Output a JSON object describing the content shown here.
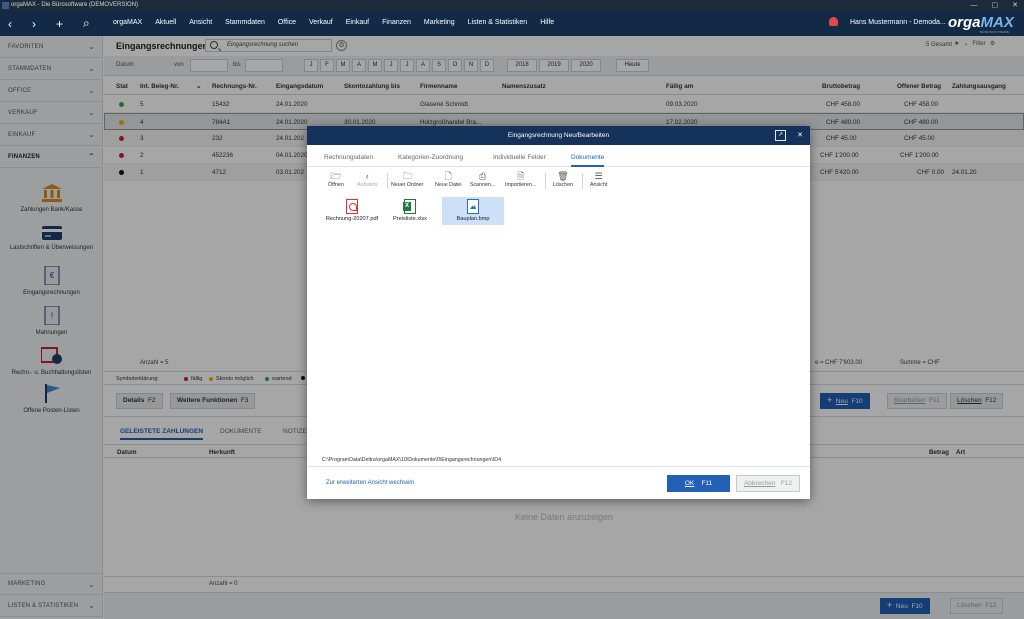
{
  "window": {
    "title": "orgaMAX - Die Bürosoftware (DEMOVERSION)",
    "controls": [
      "—",
      "▢",
      "✕"
    ]
  },
  "menubar": {
    "nav": {
      "back": "‹",
      "forward": "›",
      "add": "+",
      "search": "⌕"
    },
    "items": [
      "orgaMAX",
      "Aktuell",
      "Ansicht",
      "Stammdaten",
      "Office",
      "Verkauf",
      "Einkauf",
      "Finanzen",
      "Marketing",
      "Listen & Statistiken",
      "Hilfe"
    ],
    "user": "Hans Mustermann - Demoda...",
    "brand": {
      "orga": "orga",
      "max": "MAX",
      "tagline": "BÜROSOFTWARE"
    }
  },
  "sidebar": {
    "sections": [
      {
        "label": "FAVORITEN",
        "chevron": "⌄"
      },
      {
        "label": "STAMMDATEN",
        "chevron": "⌄"
      },
      {
        "label": "OFFICE",
        "chevron": "⌄"
      },
      {
        "label": "VERKAUF",
        "chevron": "⌄"
      },
      {
        "label": "EINKAUF",
        "chevron": "⌄"
      },
      {
        "label": "FINANZEN",
        "chevron": "⌃"
      }
    ],
    "tools": [
      "Zahlungen Bank/Kasse",
      "Lastschriften & Überweisungen",
      "Eingangsrechnungen",
      "Mahnungen",
      "Rechn.- u. Buchhaltungslisten",
      "Offene Posten-Listen"
    ],
    "bottom_sections": [
      {
        "label": "MARKETING",
        "chevron": "⌄"
      },
      {
        "label": "LISTEN & STATISTIKEN",
        "chevron": "⌄"
      }
    ]
  },
  "header": {
    "title": "Eingangsrechnungen",
    "search_placeholder": "Eingangsrechnung suchen",
    "total": "5 Gesamt",
    "filter": "Filter"
  },
  "datebar": {
    "datum": "Datum",
    "von": "von",
    "bis": "bis",
    "months": [
      "J",
      "F",
      "M",
      "A",
      "M",
      "J",
      "J",
      "A",
      "S",
      "O",
      "N",
      "D"
    ],
    "years": [
      "2018",
      "2019",
      "2020"
    ],
    "today": "Heute"
  },
  "table": {
    "columns": [
      "Stat",
      "Int. Beleg-Nr.",
      "Rechnungs-Nr.",
      "Eingangsdatum",
      "Skontozahlung bis",
      "Firmenname",
      "Namenszusatz",
      "Fällig am",
      "Bruttobetrag",
      "Offener Betrag",
      "Zahlungsausgang"
    ],
    "rows": [
      {
        "status_color": "#2ea84f",
        "beleg": "5",
        "rechnung": "15432",
        "eingang": "24.01.2020",
        "skonto": "",
        "firma": "Glaserei Schmidt",
        "faellig": "09.03.2020",
        "brutto": "CHF 458.00",
        "offen": "CHF 458.00",
        "ausgang": ""
      },
      {
        "status_color": "#f0b400",
        "beleg": "4",
        "rechnung": "784A1",
        "eingang": "24.01.2020",
        "skonto": "30.01.2020",
        "firma": "Holzgroßhandel Bra...",
        "faellig": "17.02.2020",
        "brutto": "CHF 480.00",
        "offen": "CHF 480.00",
        "ausgang": ""
      },
      {
        "status_color": "#c8232c",
        "beleg": "3",
        "rechnung": "232",
        "eingang": "24.01.202",
        "skonto": "",
        "firma": "",
        "faellig": "",
        "brutto": "CHF 45.00",
        "offen": "CHF 45.00",
        "ausgang": ""
      },
      {
        "status_color": "#c8232c",
        "beleg": "2",
        "rechnung": "452236",
        "eingang": "04.01.2020",
        "skonto": "",
        "firma": "",
        "faellig": "",
        "brutto": "CHF 1'200.00",
        "offen": "CHF 1'200.00",
        "ausgang": ""
      },
      {
        "status_color": "#111111",
        "beleg": "1",
        "rechnung": "4712",
        "eingang": "03.01.202",
        "skonto": "",
        "firma": "",
        "faellig": "",
        "brutto": "CHF 5'420.00",
        "offen": "CHF 0.00",
        "ausgang": "24.01.20"
      }
    ],
    "count": "Anzahl = 5",
    "sum_brutto": "e = CHF 7'603.00",
    "sum_offen": "Summe = CHF"
  },
  "legend": {
    "label": "Symbolerklärung:",
    "items": [
      {
        "label": "fällig",
        "color": "#c8232c"
      },
      {
        "label": "Skonto möglich",
        "color": "#f0b400"
      },
      {
        "label": "wartend",
        "color": "#2ea84f"
      },
      {
        "label": "",
        "color": "#111111"
      }
    ]
  },
  "actions": {
    "details": "Details",
    "details_key": "F2",
    "weitere": "Weitere Funktionen",
    "weitere_key": "F3",
    "neu": "Neu",
    "neu_key": "F10",
    "bearbeiten": "Bearbeiten",
    "bearbeiten_key": "F11",
    "loeschen": "Löschen",
    "loeschen_key": "F12"
  },
  "subtabs": [
    "GELEISTETE ZAHLUNGEN",
    "DOKUMENTE",
    "NOTIZE"
  ],
  "subtable": {
    "columns": [
      "Datum",
      "Herkunft",
      "Betrag",
      "Art"
    ],
    "empty": "Keine Daten anzuzeigen",
    "count": "Anzahl = 0"
  },
  "bottom": {
    "neu": "Neu",
    "neu_key": "F10",
    "loeschen": "Löschen",
    "loeschen_key": "F12"
  },
  "modal": {
    "title": "Eingangsrechnung Neu/Bearbeiten",
    "tabs": [
      "Rechnungsdaten",
      "Kategorien-Zuordnung",
      "Individuelle Felder",
      "Dokumente"
    ],
    "toolbar": [
      "Öffnen",
      "Aufwärts",
      "Neuer Ordner",
      "Neue Datei",
      "Scannen...",
      "Importieren...",
      "Löschen",
      "Ansicht"
    ],
    "files": [
      {
        "name": "Rechnung-20207.pdf",
        "icon": "pdf-file-icon"
      },
      {
        "name": "Preisliste.xlsx",
        "icon": "excel-file-icon"
      },
      {
        "name": "Bauplan.bmp",
        "icon": "image-file-icon"
      }
    ],
    "path": "C:\\ProgramData\\Deltra\\orgaMAX\\10\\Dokumente\\0\\Eingangsrechnungen\\ID4",
    "link": "Zur erweiterten Ansicht wechseln",
    "ok": "OK",
    "ok_key": "F11",
    "abbrechen": "Abbrechen",
    "abbrechen_key": "F12"
  }
}
